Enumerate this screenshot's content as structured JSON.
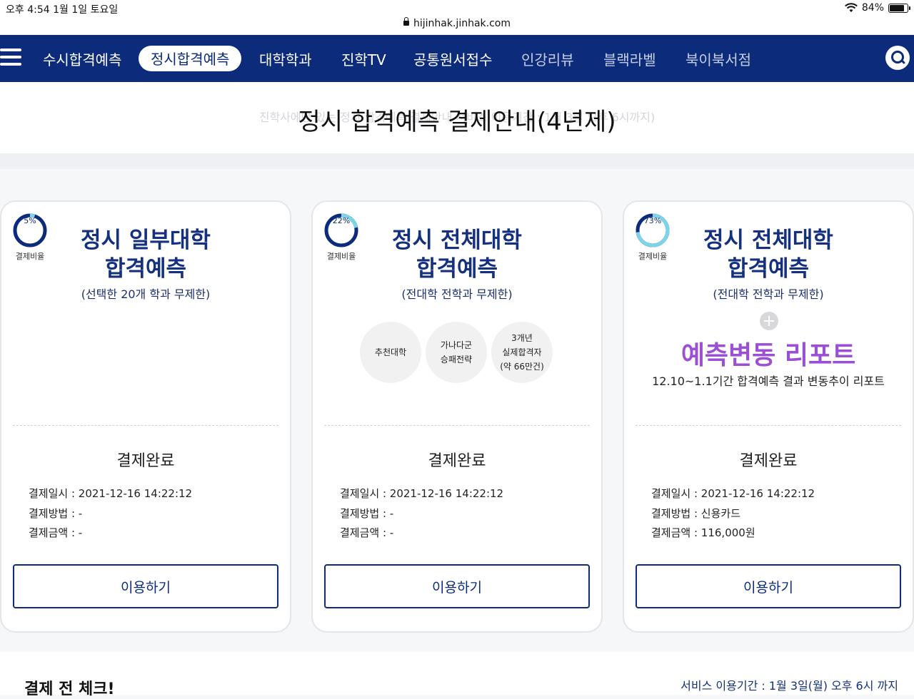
{
  "status_bar": {
    "time": "오후 4:54   1월 1일 토요일",
    "battery": "84%",
    "battery_level": 0.84,
    "url": "hijinhak.jinhak.com"
  },
  "nav": {
    "items": [
      "수시합격예측",
      "정시합격예측",
      "대학학과",
      "진학TV",
      "공통원서접수",
      "인강리뷰",
      "블랙라벨",
      "북이북서점"
    ],
    "active_index": 1
  },
  "header": {
    "title": "정시 합격예측 결제안내(4년제)",
    "subtitle": "진학사에만 있는 정시 합격예측 결제안내 서비스 이용기간 : 1월 3일 오후 6시까지)"
  },
  "cards": [
    {
      "percent": "5%",
      "percent_value": 0.05,
      "percent_caption": "결제비율",
      "title_line1": "정시 일부대학",
      "title_line2": "합격예측",
      "paren": "(선택한 20개 학과 무제한)",
      "status": "결제완료",
      "date": "결제일시 : 2021-12-16 14:22:12",
      "method": "결제방법 : -",
      "amount": "결제금액 : -",
      "button": "이용하기"
    },
    {
      "percent": "22%",
      "percent_value": 0.22,
      "percent_caption": "결제비율",
      "title_line1": "정시 전체대학",
      "title_line2": "합격예측",
      "paren": "(전대학 전학과 무제한)",
      "features": [
        "추천대학",
        "가나다군\n승패전략",
        "3개년\n실제합격자\n(약 66만건)"
      ],
      "status": "결제완료",
      "date": "결제일시 : 2021-12-16 14:22:12",
      "method": "결제방법 : -",
      "amount": "결제금액 : -",
      "button": "이용하기"
    },
    {
      "percent": "73%",
      "percent_value": 0.73,
      "percent_caption": "결제비율",
      "title_line1": "정시 전체대학",
      "title_line2": "합격예측",
      "paren": "(전대학 전학과 무제한)",
      "report_title": "예측변동 리포트",
      "report_desc": "12.10~1.1기간 합격예측 결과 변동추이 리포트",
      "status": "결제완료",
      "date": "결제일시 : 2021-12-16 14:22:12",
      "method": "결제방법 : 신용카드",
      "amount": "결제금액 : 116,000원",
      "button": "이용하기"
    }
  ],
  "bottom": {
    "left": "결제 전 체크!",
    "right": "서비스 이용기간 : 1월 3일(월) 오후 6시 까지"
  },
  "colors": {
    "navy": "#0c2b7a",
    "purple": "#9b4fd6",
    "donut_fill": "#7dd3e8"
  }
}
